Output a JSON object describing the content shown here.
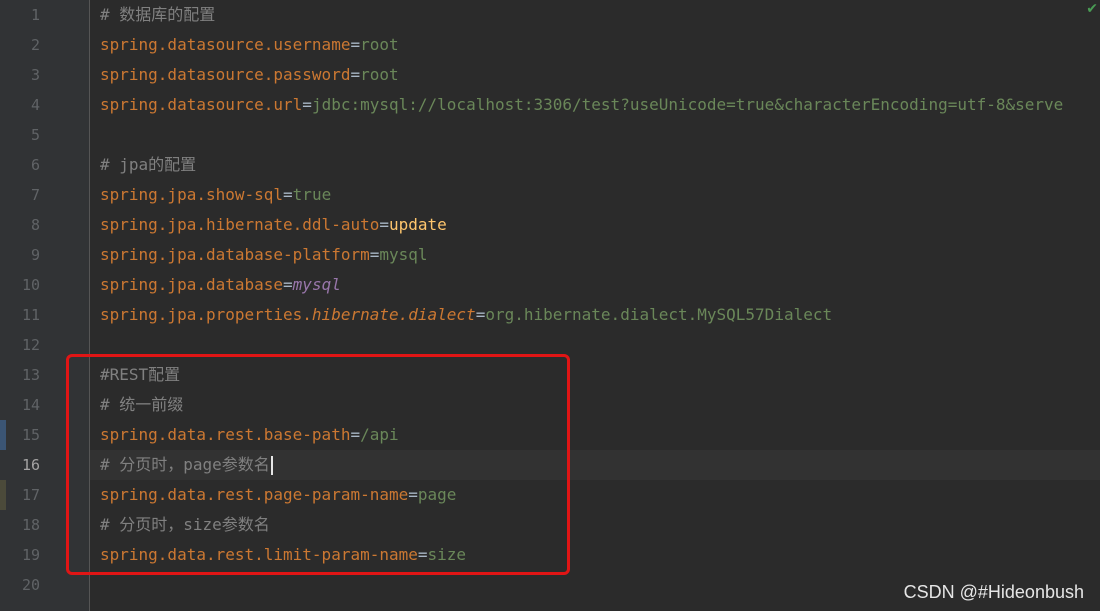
{
  "gutter": {
    "line_numbers": [
      "1",
      "2",
      "3",
      "4",
      "5",
      "6",
      "7",
      "8",
      "9",
      "10",
      "11",
      "12",
      "13",
      "14",
      "15",
      "16",
      "17",
      "18",
      "19",
      "20"
    ],
    "current_line": "16"
  },
  "code": [
    {
      "comment": "# 数据库的配置"
    },
    {
      "key": "spring.datasource.username",
      "eq": "=",
      "value": "root"
    },
    {
      "key": "spring.datasource.password",
      "eq": "=",
      "value": "root"
    },
    {
      "key": "spring.datasource.url",
      "eq": "=",
      "value": "jdbc:mysql://localhost:3306/test?useUnicode=true&characterEncoding=utf-8&serve"
    },
    {},
    {
      "comment": "# jpa的配置"
    },
    {
      "key": "spring.jpa.show-sql",
      "eq": "=",
      "value": "true"
    },
    {
      "key": "spring.jpa.hibernate.ddl-auto",
      "eq": "=",
      "value": "update"
    },
    {
      "key": "spring.jpa.database-platform",
      "eq": "=",
      "value": "mysql"
    },
    {
      "key": "spring.jpa.database",
      "eq": "=",
      "value": "mysql"
    },
    {
      "key_a": "spring.jpa.properties.",
      "key_b": "hibernate.dialect",
      "eq": "=",
      "value": "org.hibernate.dialect.MySQL57Dialect"
    },
    {},
    {
      "comment": "#REST配置"
    },
    {
      "comment": "# 统一前缀"
    },
    {
      "key": "spring.data.rest.base-path",
      "eq": "=",
      "value": "/api"
    },
    {
      "comment": "# 分页时，page参数名"
    },
    {
      "key": "spring.data.rest.page-param-name",
      "eq": "=",
      "value": "page"
    },
    {
      "comment": "# 分页时，size参数名"
    },
    {
      "key": "spring.data.rest.limit-param-name",
      "eq": "=",
      "value": "size"
    },
    {}
  ],
  "watermark": "CSDN @#Hideonbush",
  "check_icon": "✔",
  "colors": {
    "background": "#2b2b2b",
    "gutter": "#313335",
    "comment": "#808080",
    "key": "#cc7832",
    "value": "#6a8759",
    "value_keyword": "#ffc66d",
    "value_italic": "#9876aa",
    "highlight_box": "#e01515"
  }
}
